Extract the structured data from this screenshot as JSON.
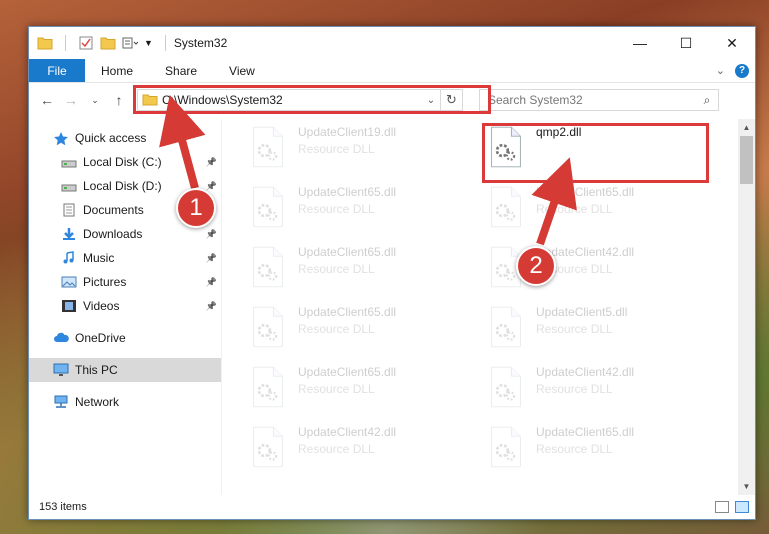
{
  "window": {
    "title": "System32",
    "controls": {
      "minimize": "—",
      "maximize": "☐",
      "close": "✕"
    }
  },
  "ribbon": {
    "tabs": [
      "File",
      "Home",
      "Share",
      "View"
    ],
    "help_label": "?"
  },
  "navigation": {
    "address_path": "C:\\Windows\\System32",
    "search_placeholder": "Search System32"
  },
  "sidebar": {
    "items": [
      {
        "label": "Quick access",
        "icon": "star-icon",
        "pinned": false,
        "sub": false
      },
      {
        "label": "Local Disk (C:)",
        "icon": "drive-icon",
        "pinned": true,
        "sub": true
      },
      {
        "label": "Local Disk (D:)",
        "icon": "drive-icon",
        "pinned": true,
        "sub": true
      },
      {
        "label": "Documents",
        "icon": "documents-icon",
        "pinned": true,
        "sub": true
      },
      {
        "label": "Downloads",
        "icon": "download-icon",
        "pinned": true,
        "sub": true
      },
      {
        "label": "Music",
        "icon": "music-icon",
        "pinned": true,
        "sub": true
      },
      {
        "label": "Pictures",
        "icon": "pictures-icon",
        "pinned": true,
        "sub": true
      },
      {
        "label": "Videos",
        "icon": "videos-icon",
        "pinned": true,
        "sub": true
      },
      {
        "label": "OneDrive",
        "icon": "cloud-icon",
        "pinned": false,
        "sub": false
      },
      {
        "label": "This PC",
        "icon": "computer-icon",
        "pinned": false,
        "sub": false,
        "selected": true
      },
      {
        "label": "Network",
        "icon": "network-icon",
        "pinned": false,
        "sub": false
      }
    ]
  },
  "files": [
    {
      "name": "UpdateClient19.dll",
      "type": "Resource DLL",
      "col": 0,
      "row": 0,
      "faded": true
    },
    {
      "name": "qmp2.dll",
      "type": "",
      "col": 1,
      "row": 0,
      "faded": false
    },
    {
      "name": "UpdateClient65.dll",
      "type": "Resource DLL",
      "col": 0,
      "row": 1,
      "faded": true
    },
    {
      "name": "UpdateClient65.dll",
      "type": "Resource DLL",
      "col": 1,
      "row": 1,
      "faded": true
    },
    {
      "name": "UpdateClient65.dll",
      "type": "Resource DLL",
      "col": 0,
      "row": 2,
      "faded": true
    },
    {
      "name": "UpdateClient42.dll",
      "type": "Resource DLL",
      "col": 1,
      "row": 2,
      "faded": true
    },
    {
      "name": "UpdateClient65.dll",
      "type": "Resource DLL",
      "col": 0,
      "row": 3,
      "faded": true
    },
    {
      "name": "UpdateClient5.dll",
      "type": "Resource DLL",
      "col": 1,
      "row": 3,
      "faded": true
    },
    {
      "name": "UpdateClient65.dll",
      "type": "Resource DLL",
      "col": 0,
      "row": 4,
      "faded": true
    },
    {
      "name": "UpdateClient42.dll",
      "type": "Resource DLL",
      "col": 1,
      "row": 4,
      "faded": true
    },
    {
      "name": "UpdateClient42.dll",
      "type": "Resource DLL",
      "col": 0,
      "row": 5,
      "faded": true
    },
    {
      "name": "UpdateClient65.dll",
      "type": "Resource DLL",
      "col": 1,
      "row": 5,
      "faded": true
    }
  ],
  "status": {
    "item_count": "153 items"
  },
  "callouts": [
    "1",
    "2"
  ],
  "colors": {
    "accent": "#1979ca",
    "highlight": "#dc3a3a",
    "callout": "#d63a34"
  }
}
